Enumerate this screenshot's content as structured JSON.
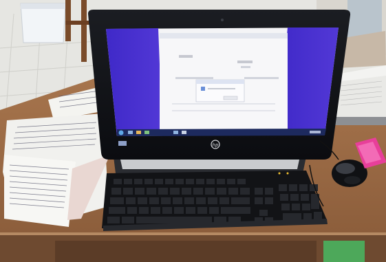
{
  "scene": {
    "subject": "hp-all-in-one-desktop",
    "monitor": {
      "brand_logo": "hp-logo",
      "screen": {
        "background_color": "#4a2fd0",
        "window_color": "#f4f4f6",
        "taskbar_color": "#1d2a5e",
        "state": "dialog-open"
      }
    },
    "desk_items": [
      "keyboard",
      "mouse",
      "handwritten-papers",
      "paper-stack",
      "pink-stapler"
    ],
    "colors": {
      "desk_wood": "#9a6a45",
      "floor_tile": "#e7e7e2",
      "bezel": "#0f1115",
      "keyboard": "#141518",
      "stapler": "#e83f9a"
    }
  }
}
